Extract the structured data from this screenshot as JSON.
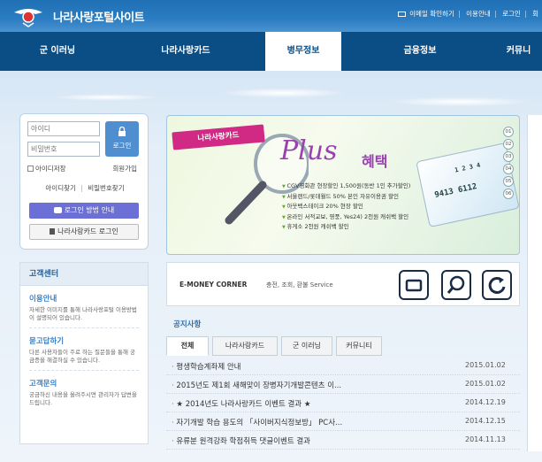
{
  "header": {
    "site_title": "나라사랑포털사이트",
    "utility": [
      "이메일 확인하기",
      "이용안내",
      "로그인",
      "회"
    ]
  },
  "gnb": {
    "items": [
      "군 이러닝",
      "나라사랑카드",
      "병무정보",
      "금융정보",
      "커뮤니"
    ],
    "active_index": 2
  },
  "login": {
    "id_placeholder": "아이디",
    "pw_placeholder": "비밀번호",
    "login_button": "로그인",
    "save_id": "아이디저장",
    "join": "회원가입",
    "find_id": "아이디찾기",
    "find_sep": "|",
    "find_pw": "비밀번호찾기",
    "guide_button": "로그인 방법 안내",
    "card_login_button": "나라사랑카드 로그인"
  },
  "customer_center": {
    "title": "고객센터",
    "items": [
      {
        "heading": "이용안내",
        "desc": "자세한 이미지를 통해 나라사랑포털 이용방법이 설명되어 있습니다."
      },
      {
        "heading": "묻고답하기",
        "desc": "다른 사용자들이 주로 하는 질문들을 통해 궁금증을 해결하실 수 있습니다."
      },
      {
        "heading": "고객문의",
        "desc": "궁금하신 내용을 올려주시면 관리자가 답변을 드립니다."
      }
    ]
  },
  "banner": {
    "ribbon": "나라사랑카드",
    "plus": "Plus",
    "benefit_word": "혜택",
    "benefits": [
      "CGV영화관 현장할인 1,500원(동반 1인 추가할인)",
      "서울랜드/롯데월드 50% 본인 자유이용권 할인",
      "아웃백스테이크 20% 현장 할인",
      "온라인 서적교보, 영풍, Yes24) 2천원 캐쉬백 할인",
      "휴게소 2천원 캐쉬백 할인"
    ],
    "card_number": "9413 6112",
    "card_number_top": "1 2 3 4",
    "pager": [
      "01",
      "02",
      "03",
      "04",
      "05",
      "06"
    ]
  },
  "emoney": {
    "title": "E-MONEY CORNER",
    "sub": "충전, 조회, 환불 Service",
    "buttons": [
      "card-icon",
      "search-icon",
      "refresh-icon"
    ]
  },
  "notice": {
    "title": "공지사항",
    "tabs": [
      "전체",
      "나라사랑카드",
      "군 이러닝",
      "커뮤니티"
    ],
    "active_tab": 0,
    "rows": [
      {
        "title": "평생학습계좌제 안내",
        "date": "2015.01.02"
      },
      {
        "title": "2015년도 제1회 새해맞이 장병자기개발콘텐츠 이...",
        "date": "2015.01.02"
      },
      {
        "title": "★ 2014년도 나라사랑카드 이벤트 결과 ★",
        "date": "2014.12.19"
      },
      {
        "title": "자기개발 학습 용도의 「사이버지식정보방」 PC사...",
        "date": "2014.12.15"
      },
      {
        "title": "유류분 원격강좌 학점취득 댓글이벤트 결과",
        "date": "2014.11.13"
      }
    ]
  },
  "colors": {
    "nav": "#0b4e85",
    "accent": "#3d7fc1",
    "promo": "#9a40b0"
  }
}
